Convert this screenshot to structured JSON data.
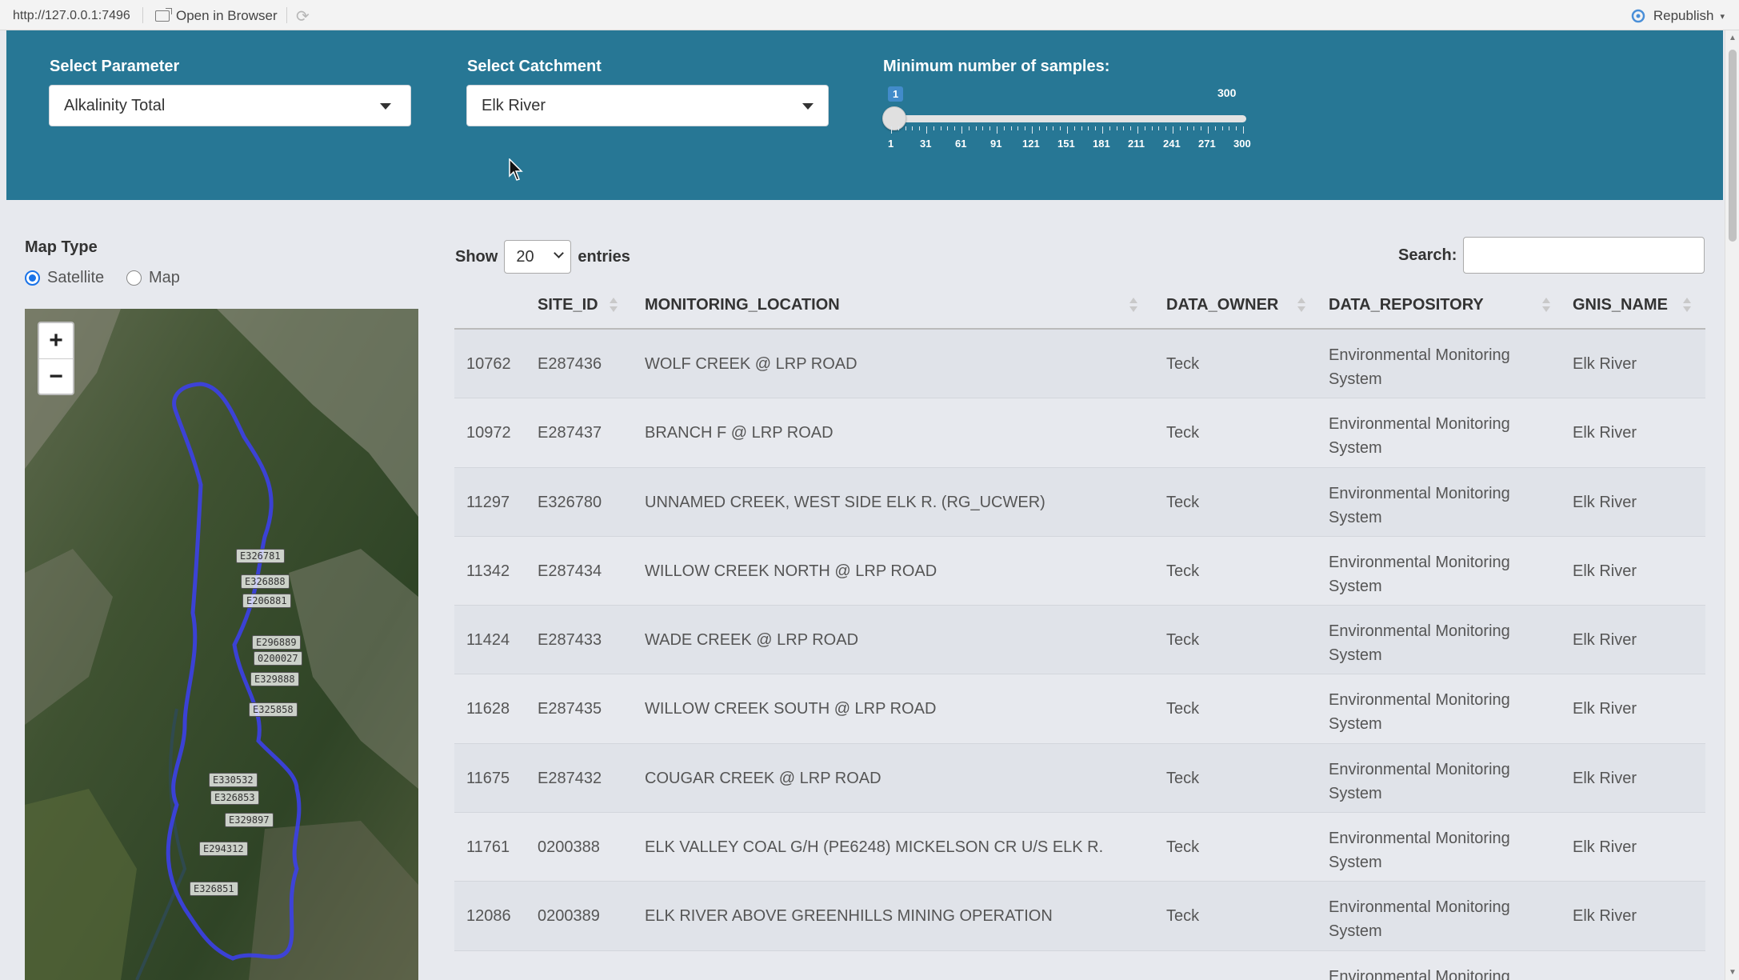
{
  "topbar": {
    "url": "http://127.0.0.1:7496",
    "open_in_browser": "Open in Browser",
    "republish": "Republish"
  },
  "header": {
    "parameter": {
      "label": "Select Parameter",
      "value": "Alkalinity Total"
    },
    "catchment": {
      "label": "Select Catchment",
      "value": "Elk River"
    },
    "samples": {
      "label": "Minimum number of samples:",
      "value": "1",
      "max": "300",
      "tick_labels": [
        "1",
        "31",
        "61",
        "91",
        "121",
        "151",
        "181",
        "211",
        "241",
        "271",
        "300"
      ]
    }
  },
  "sidebar": {
    "map_type_label": "Map Type",
    "options": [
      {
        "label": "Satellite",
        "selected": true
      },
      {
        "label": "Map",
        "selected": false
      }
    ],
    "zoom_in": "+",
    "zoom_out": "−",
    "site_labels": [
      "E326781",
      "E326888",
      "E206881",
      "E296889",
      "0200027",
      "E329888",
      "E325858",
      "E330532",
      "E326853",
      "E329897",
      "E294312",
      "E326851"
    ]
  },
  "table": {
    "show_label": "Show",
    "entries_value": "20",
    "entries_label": "entries",
    "search_label": "Search:",
    "search_value": "",
    "columns": [
      "SITE_ID",
      "MONITORING_LOCATION",
      "DATA_OWNER",
      "DATA_REPOSITORY",
      "GNIS_NAME"
    ],
    "rows": [
      [
        "10762",
        "E287436",
        "WOLF CREEK @ LRP ROAD",
        "Teck",
        "Environmental Monitoring System",
        "Elk River"
      ],
      [
        "10972",
        "E287437",
        "BRANCH F @ LRP ROAD",
        "Teck",
        "Environmental Monitoring System",
        "Elk River"
      ],
      [
        "11297",
        "E326780",
        "UNNAMED CREEK, WEST SIDE ELK R. (RG_UCWER)",
        "Teck",
        "Environmental Monitoring System",
        "Elk River"
      ],
      [
        "11342",
        "E287434",
        "WILLOW CREEK NORTH @ LRP ROAD",
        "Teck",
        "Environmental Monitoring System",
        "Elk River"
      ],
      [
        "11424",
        "E287433",
        "WADE CREEK @ LRP ROAD",
        "Teck",
        "Environmental Monitoring System",
        "Elk River"
      ],
      [
        "11628",
        "E287435",
        "WILLOW CREEK SOUTH @ LRP ROAD",
        "Teck",
        "Environmental Monitoring System",
        "Elk River"
      ],
      [
        "11675",
        "E287432",
        "COUGAR CREEK @ LRP ROAD",
        "Teck",
        "Environmental Monitoring System",
        "Elk River"
      ],
      [
        "11761",
        "0200388",
        "ELK VALLEY COAL G/H (PE6248) MICKELSON CR U/S ELK R.",
        "Teck",
        "Environmental Monitoring System",
        "Elk River"
      ],
      [
        "12086",
        "0200389",
        "ELK RIVER ABOVE GREENHILLS MINING OPERATION",
        "Teck",
        "Environmental Monitoring System",
        "Elk River"
      ],
      [
        "",
        "",
        "",
        "",
        "Environmental Monitoring",
        ""
      ]
    ]
  }
}
